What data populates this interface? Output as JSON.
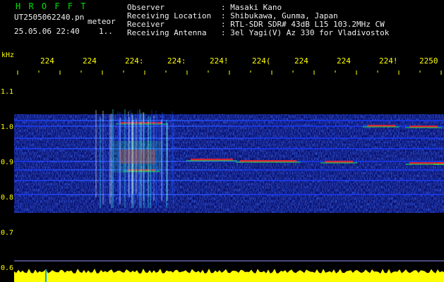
{
  "header": {
    "brand": "H R O F F T",
    "filename": "UT2505062240.pn",
    "meteor_tag": "meteor",
    "datetime": "25.05.06 22:40",
    "count": "1..",
    "observer_label": "Observer",
    "observer_value": ": Masaki Kano",
    "location_label": "Receiving Location",
    "location_value": ": Shibukawa, Gunma, Japan",
    "receiver_label": "Receiver",
    "receiver_value": ": RTL-SDR SDR# 43dB L15 103.2MHz CW",
    "antenna_label": "Receiving Antenna",
    "antenna_value": ": 3el Yagi(V) Az 330 for Vladivostok"
  },
  "axis": {
    "unit": "kHz",
    "y_ticks": [
      "1.1",
      "1.0",
      "0.9",
      "0.8",
      "0.7",
      "0.6"
    ],
    "x_ticks": [
      "224",
      "224",
      "224:",
      "224:",
      "224!",
      "224(",
      "224",
      "224",
      "224!",
      "2250"
    ]
  },
  "colors": {
    "background": "#000000",
    "axis_text": "#ffff00",
    "brand": "#00e000",
    "signal_low": "#0000a0",
    "signal_high": "#ff0000",
    "level_bar": "#ffff00"
  }
}
